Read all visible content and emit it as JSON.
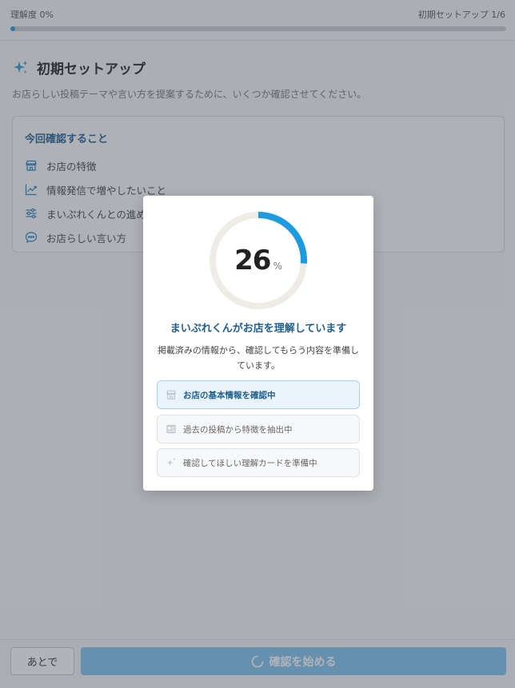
{
  "header": {
    "progress_label": "理解度 0%",
    "step_label": "初期セットアップ 1/6",
    "progress_value": 0.01
  },
  "page": {
    "title": "初期セットアップ",
    "subtitle": "お店らしい投稿テーマや言い方を提案するために、いくつか確認させてください。"
  },
  "checklist": {
    "heading": "今回確認すること",
    "items": [
      {
        "label": "お店の特徴",
        "icon": "store-icon"
      },
      {
        "label": "情報発信で増やしたいこと",
        "icon": "trend-chart-icon"
      },
      {
        "label": "まいぷれくんとの進め方",
        "icon": "sliders-icon"
      },
      {
        "label": "お店らしい言い方",
        "icon": "chat-bubble-icon"
      }
    ]
  },
  "modal": {
    "percent": 26,
    "percent_unit": "%",
    "title": "まいぷれくんがお店を理解しています",
    "description": "掲載済みの情報から、確認してもらう内容を準備しています。",
    "steps": [
      {
        "label": "お店の基本情報を確認中",
        "icon": "store-icon",
        "state": "active"
      },
      {
        "label": "過去の投稿から特徴を抽出中",
        "icon": "document-icon",
        "state": "pending"
      },
      {
        "label": "確認してほしい理解カードを準備中",
        "icon": "sparkle-icon",
        "state": "pending"
      }
    ]
  },
  "footer": {
    "later_label": "あとで",
    "start_label": "確認を始める"
  },
  "colors": {
    "accent": "#1e9be0",
    "heading_blue": "#1d5f8f",
    "ring_track": "#efece6"
  }
}
